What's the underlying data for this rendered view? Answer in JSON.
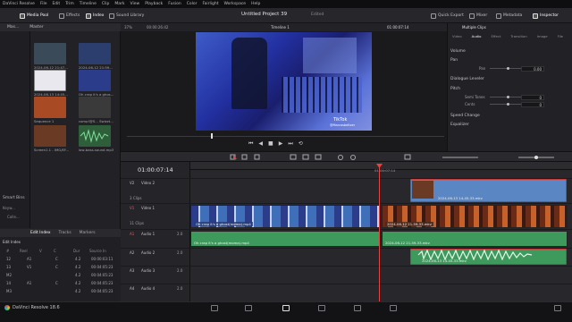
{
  "menubar": [
    "DaVinci Resolve",
    "File",
    "Edit",
    "Trim",
    "Timeline",
    "Clip",
    "Mark",
    "View",
    "Playback",
    "Fusion",
    "Color",
    "Fairlight",
    "Workspace",
    "Help"
  ],
  "toolbar": {
    "media_pool": "Media Pool",
    "effects": "Effects",
    "index": "Index",
    "sound_library": "Sound Library",
    "quick_export": "Quick Export",
    "mixer": "Mixer",
    "metadata": "Metadata",
    "inspector": "Inspector"
  },
  "project": {
    "title": "Untitled Project 39",
    "status": "Edited"
  },
  "media_pool": {
    "tabs": [
      "Mas...",
      "Master"
    ],
    "clips": [
      {
        "label": "2024-06-12 21:47...",
        "color": "#3a4a58"
      },
      {
        "label": "2024-06-12 21:59...",
        "color": "#2c3e6e"
      },
      {
        "label": "2024-06-13 14:45...",
        "color": "#e8e8ee"
      },
      {
        "label": "Oh crap it's a ghos...",
        "color": "#2a3c8a"
      },
      {
        "label": "Sequence 1",
        "color": "#a84a24"
      },
      {
        "label": "comp!@S... Swizzt...",
        "color": "#3a3a3a"
      },
      {
        "label": "Screen1.1 - IMG/EF...",
        "color": "#6a3a24"
      },
      {
        "label": "low-bass-sound.mp3",
        "color": "#2e5e3a"
      }
    ],
    "smart_bins": "Smart Bins",
    "smart_bins_items": [
      "Keyw...",
      "Colle..."
    ]
  },
  "viewer": {
    "zoom": "37%",
    "timecode_left": "00:00:26:42",
    "timeline_name": "Timeline 1",
    "timecode_right": "01:00:07:14",
    "watermark_brand": "TikTok",
    "watermark_user": "@Marcosbeltzer"
  },
  "inspector": {
    "header": "Multiple Clips",
    "tabs": [
      "Video",
      "Audio",
      "Effect",
      "Transition",
      "Image",
      "File"
    ],
    "rows": [
      {
        "label": "Volume"
      },
      {
        "label": "Pan"
      },
      {
        "label": "Pan",
        "value": "0.00"
      },
      {
        "label": "Dialogue Leveler"
      },
      {
        "label": "Pitch"
      },
      {
        "label": "Semi Tones",
        "value": "0"
      },
      {
        "label": "Cents",
        "value": "0"
      },
      {
        "label": "Speed Change"
      },
      {
        "label": "Equalizer"
      }
    ]
  },
  "timeline": {
    "timecode": "01:00:07:14",
    "ruler_mark": "01:00:07:14",
    "tracks": [
      {
        "id": "V2",
        "name": "Video 2",
        "clips": "3 Clips"
      },
      {
        "id": "V1",
        "name": "Video 1",
        "clips": "11 Clips"
      },
      {
        "id": "A1",
        "name": "Audio 1",
        "value": "2.0"
      },
      {
        "id": "A2",
        "name": "Audio 2",
        "value": "2.0"
      },
      {
        "id": "A3",
        "name": "Audio 3",
        "value": "2.0"
      },
      {
        "id": "A4",
        "name": "Audio 4",
        "value": "2.0"
      }
    ],
    "clips": {
      "v2": "2024-06-13 14-45-33.mkv",
      "v1_a": "Oh crap it's a ghost(moma).mp4",
      "v1_b": "2024-06-12 21-59-33.mkv",
      "a1_a": "Oh crap it's a ghost(moma).mp4",
      "a1_b": "2024-06-12 21-59-33.mkv",
      "a2": "2024-06-13 14-45-33.mkv"
    }
  },
  "edit_index": {
    "title": "Edit Index",
    "tabs": [
      "Edit Index",
      "Tracks",
      "Markers"
    ],
    "rows": [
      [
        "#",
        "Reel",
        "V",
        "C",
        "Dur",
        "Source In"
      ],
      [
        "12",
        "A1",
        "C",
        "",
        "4.2",
        "00:00:03:11"
      ],
      [
        "13",
        "V1",
        "C",
        "",
        "4.2",
        "00:04:05:23"
      ],
      [
        "M2",
        "",
        "",
        "",
        "4.2",
        "00:04:05:23"
      ],
      [
        "14",
        "A1",
        "C",
        "",
        "4.2",
        "00:04:05:23"
      ],
      [
        "M3",
        "",
        "",
        "",
        "4.2",
        "00:04:05:23"
      ]
    ]
  },
  "footer": {
    "app_name": "DaVinci Resolve 18.6"
  },
  "colors": {
    "playhead": "#e8433f",
    "video_clip": "#3f6fb8",
    "audio_clip": "#3d9a5c",
    "v2_clip": "#5a86c4"
  }
}
